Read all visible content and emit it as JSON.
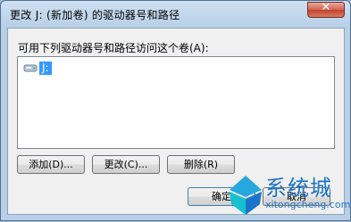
{
  "window": {
    "title": "更改 J: (新加卷) 的驱动器号和路径"
  },
  "dialog": {
    "list_label": "可用下列驱动器号和路径访问这个卷(A):",
    "list_items": [
      {
        "label": "J:",
        "icon": "drive-icon",
        "selected": true
      }
    ],
    "buttons": {
      "add": "添加(D)...",
      "change": "更改(C)...",
      "remove": "删除(R)",
      "ok": "确定",
      "cancel": "取消"
    }
  },
  "watermark": {
    "brand": "系统城",
    "domain": "xitongcheng.com"
  },
  "colors": {
    "selection": "#3399ff",
    "close_button": "#c1422d",
    "dialog_background": "#f0f0f0",
    "title_gradient": "#b8cfe7",
    "watermark": "#1b74c9"
  }
}
